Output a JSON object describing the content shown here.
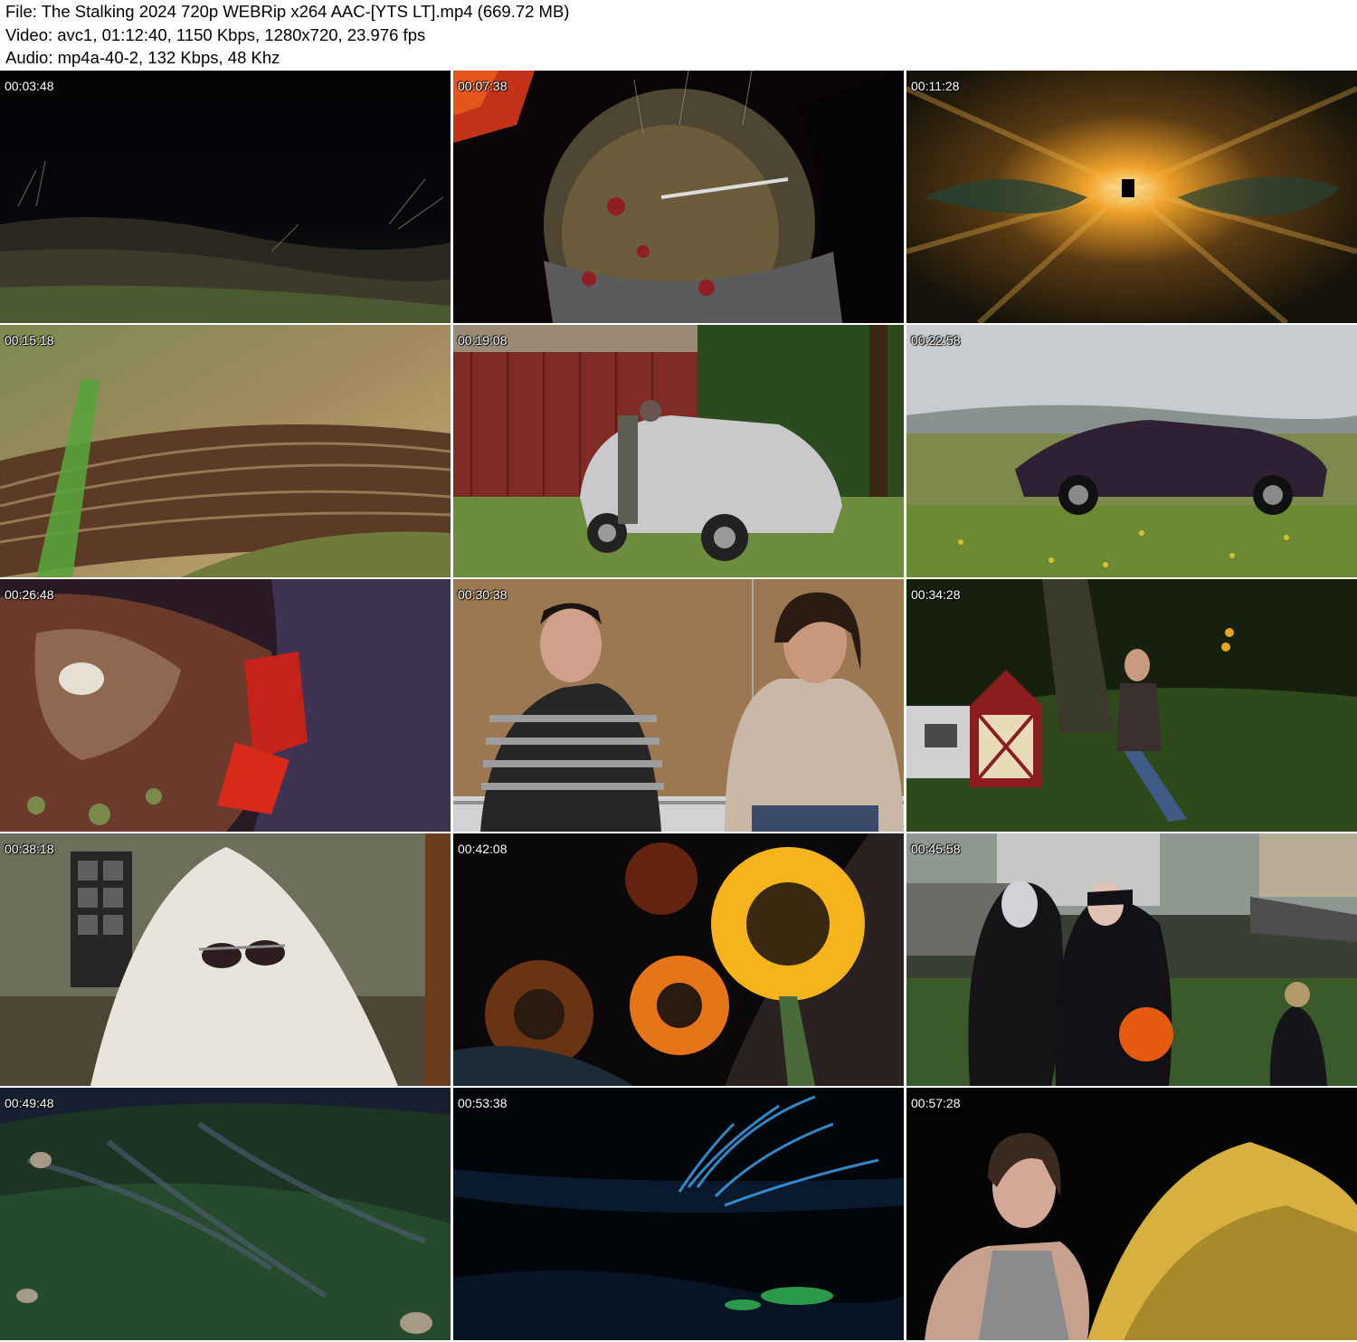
{
  "header": {
    "file_line": "File: The Stalking 2024 720p WEBRip x264 AAC-[YTS LT].mp4 (669.72 MB)",
    "video_line": "Video: avc1, 01:12:40, 1150 Kbps, 1280x720, 23.976 fps",
    "audio_line": "Audio: mp4a-40-2, 132 Kbps, 48 Khz"
  },
  "thumbnails": [
    {
      "timestamp": "00:03:48"
    },
    {
      "timestamp": "00:07:38"
    },
    {
      "timestamp": "00:11:28"
    },
    {
      "timestamp": "00:15:18"
    },
    {
      "timestamp": "00:19:08"
    },
    {
      "timestamp": "00:22:58"
    },
    {
      "timestamp": "00:26:48"
    },
    {
      "timestamp": "00:30:38"
    },
    {
      "timestamp": "00:34:28"
    },
    {
      "timestamp": "00:38:18"
    },
    {
      "timestamp": "00:42:08"
    },
    {
      "timestamp": "00:45:58"
    },
    {
      "timestamp": "00:49:48"
    },
    {
      "timestamp": "00:53:38"
    },
    {
      "timestamp": "00:57:28"
    }
  ]
}
